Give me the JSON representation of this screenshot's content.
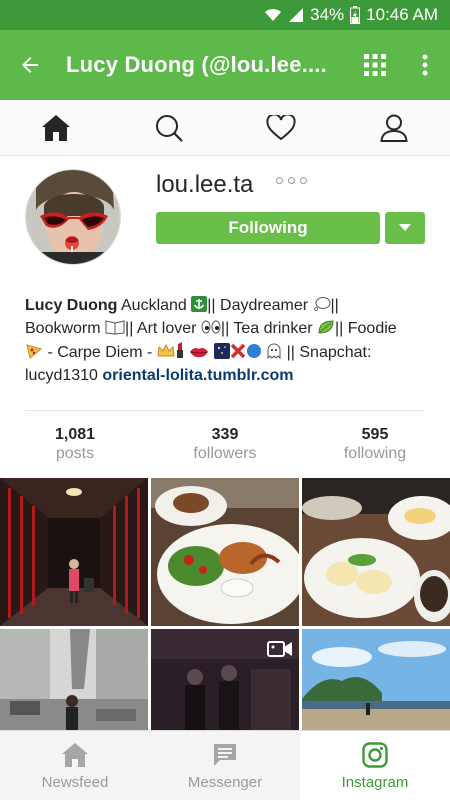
{
  "status_bar": {
    "battery": "34%",
    "time": "10:46 AM",
    "icons": [
      "wifi-icon",
      "signal-icon",
      "battery-icon"
    ]
  },
  "app_bar": {
    "title": "Lucy Duong (@lou.lee....",
    "icons": [
      "back-arrow-icon",
      "grid-icon",
      "more-vert-icon"
    ]
  },
  "tabs": [
    {
      "name": "home",
      "icon": "home-icon",
      "active": true
    },
    {
      "name": "search",
      "icon": "search-icon",
      "active": false
    },
    {
      "name": "activity",
      "icon": "heart-icon",
      "active": false
    },
    {
      "name": "profile",
      "icon": "person-icon",
      "active": false
    }
  ],
  "profile": {
    "username": "lou.lee.ta",
    "follow_label": "Following",
    "bio_name": "Lucy Duong",
    "bio_line1": " Auckland ",
    "bio_sep1": "|| Daydreamer ",
    "bio_sep2": "||",
    "bio_line2a": "Bookworm ",
    "bio_line2b": "|| Art lover ",
    "bio_line2c": "|| Tea drinker ",
    "bio_line2d": "|| Foodie",
    "bio_line3a": " - Carpe Diem - ",
    "bio_line4": "|| Snapchat:",
    "bio_line5": "lucyd1310 ",
    "bio_link": "oriental-lolita.tumblr.com"
  },
  "stats": [
    {
      "value": "1,081",
      "label": "posts"
    },
    {
      "value": "339",
      "label": "followers"
    },
    {
      "value": "595",
      "label": "following"
    }
  ],
  "grid": [
    {
      "name": "photo-corridor"
    },
    {
      "name": "photo-salad-plate"
    },
    {
      "name": "photo-brunch-table"
    },
    {
      "name": "photo-street"
    },
    {
      "name": "photo-video-dark"
    },
    {
      "name": "photo-beach"
    }
  ],
  "bottom_nav": [
    {
      "label": "Newsfeed",
      "icon": "home-icon",
      "active": false
    },
    {
      "label": "Messenger",
      "icon": "chat-icon",
      "active": false
    },
    {
      "label": "Instagram",
      "icon": "instagram-icon",
      "active": true
    }
  ],
  "colors": {
    "status_bar": "#3d9a3a",
    "app_bar": "#5cb94a",
    "button": "#6abf4b",
    "link": "#0b3b6f"
  }
}
